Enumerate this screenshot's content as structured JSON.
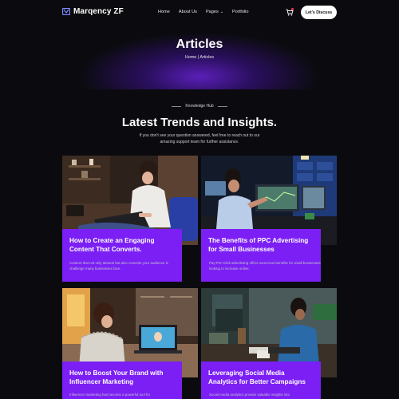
{
  "brand": {
    "name": "Marqency ZF",
    "accent": "#7b1ff5"
  },
  "nav": {
    "items": [
      {
        "label": "Home"
      },
      {
        "label": "About Us"
      },
      {
        "label": "Pages",
        "has_dropdown": true
      },
      {
        "label": "Portfolio"
      }
    ],
    "cart_icon": "cart-icon",
    "cta_label": "Let's Discuss"
  },
  "hero": {
    "title": "Articles",
    "breadcrumb": "Home | Articles"
  },
  "section": {
    "eyebrow": "Knowledge Hub",
    "title": "Latest Trends and Insights.",
    "subtitle": "If you don't see your question answered, feel free to reach out to our amazing support team for further assistance."
  },
  "articles": [
    {
      "title": "How to Create an Engaging Content That Converts.",
      "excerpt": "Content that not only attracts but also converts your audience is challenge many businesses face."
    },
    {
      "title": "The Benefits of PPC Advertising for Small Businesses",
      "excerpt": "Pay-Per-Click advertising offers numerous benefits for small businesses looking to increase online."
    },
    {
      "title": "How to Boost Your Brand with Influencer Marketing",
      "excerpt": "Influencer marketing has become a powerful tool for"
    },
    {
      "title": "Leveraging Social Media Analytics for Better Campaigns",
      "excerpt": "Social media analytics provide valuable insights into"
    }
  ]
}
